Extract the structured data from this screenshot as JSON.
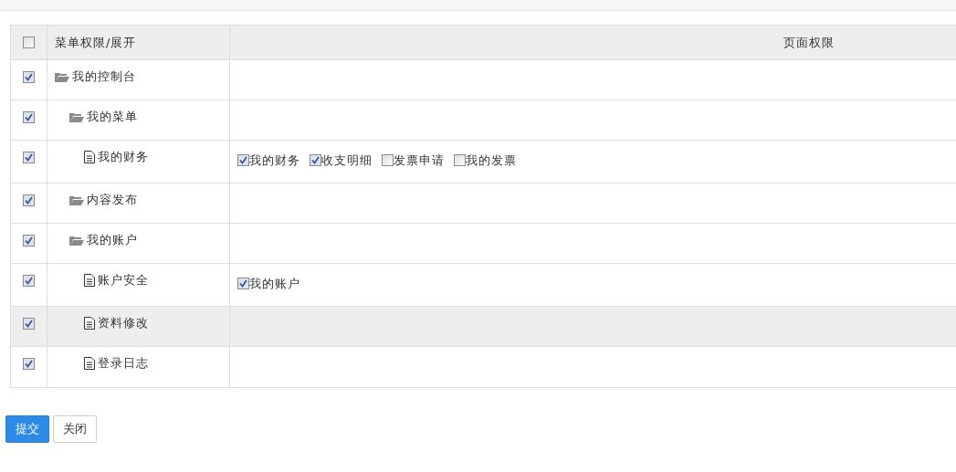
{
  "table": {
    "select_all": {
      "checked": false
    },
    "columns": [
      "菜单权限/展开",
      "页面权限"
    ],
    "tree": [
      {
        "label": "我的控制台",
        "kind": "folder",
        "checked": true,
        "selected": false,
        "children": [
          {
            "label": "我的菜单",
            "kind": "folder",
            "checked": true,
            "selected": false,
            "children": [
              {
                "label": "我的财务",
                "kind": "page",
                "checked": true,
                "selected": false,
                "permissions": [
                  {
                    "label": "我的财务",
                    "checked": true
                  },
                  {
                    "label": "收支明细",
                    "checked": true
                  },
                  {
                    "label": "发票申请",
                    "checked": false
                  },
                  {
                    "label": "我的发票",
                    "checked": false
                  }
                ]
              }
            ]
          },
          {
            "label": "内容发布",
            "kind": "folder",
            "checked": true,
            "selected": false
          },
          {
            "label": "我的账户",
            "kind": "folder",
            "checked": true,
            "selected": false,
            "children": [
              {
                "label": "账户安全",
                "kind": "page",
                "checked": true,
                "selected": false,
                "permissions": [
                  {
                    "label": "我的账户",
                    "checked": true
                  }
                ]
              },
              {
                "label": "资料修改",
                "kind": "page",
                "checked": true,
                "selected": true
              },
              {
                "label": "登录日志",
                "kind": "page",
                "checked": true,
                "selected": false
              }
            ]
          }
        ]
      }
    ]
  },
  "buttons": [
    {
      "label": "提交",
      "kind": "primary"
    },
    {
      "label": "关闭",
      "kind": "default"
    }
  ]
}
